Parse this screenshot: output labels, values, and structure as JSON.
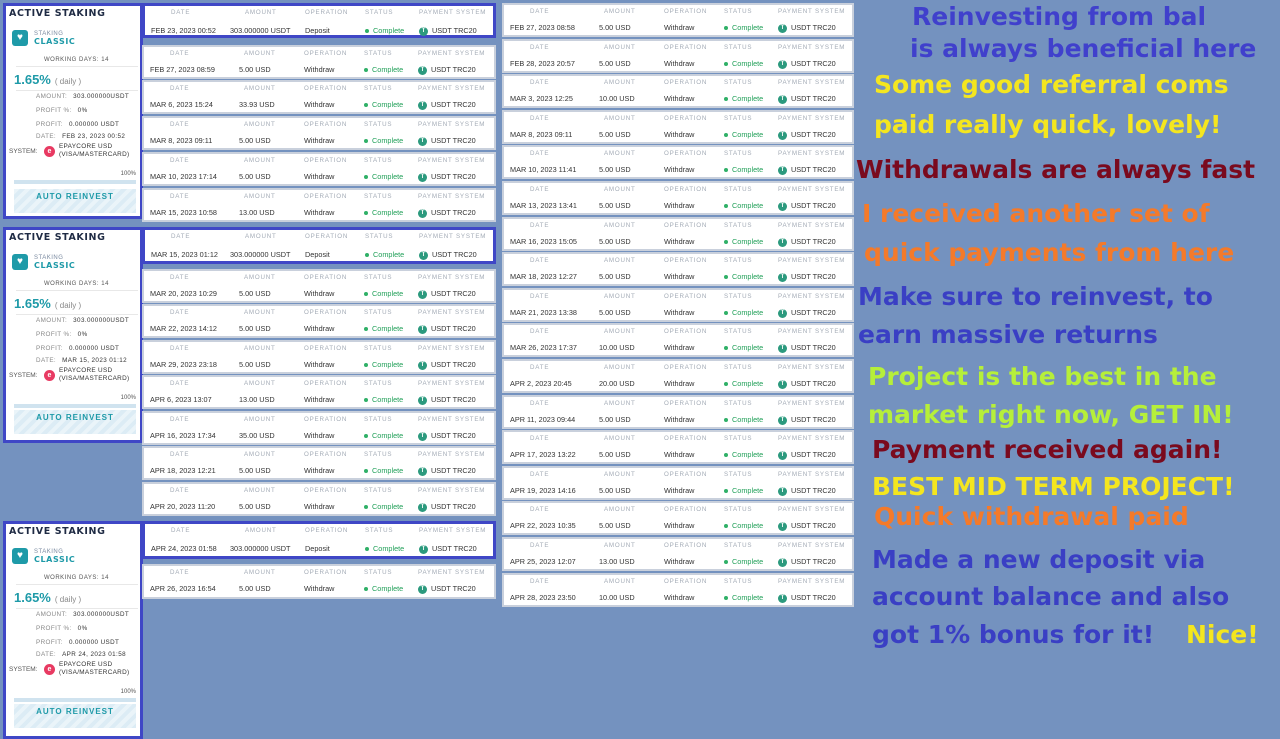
{
  "staking_cards": [
    {
      "title": "ACTIVE STAKING",
      "label": "STAKING",
      "plan": "CLASSIC",
      "working_days": "WORKING DAYS: 14",
      "rate": "1.65%",
      "period": "( daily )",
      "amount_label": "AMOUNT:",
      "amount": "303.000000USDT",
      "profit_label": "PROFIT %:",
      "profit_pct": "0%",
      "profit2_label": "PROFIT:",
      "profit": "0.000000 USDT",
      "date_label": "DATE:",
      "date": "FEB 23, 2023 00:52",
      "system_label": "SYSTEM:",
      "system_line1": "EPAYCORE USD",
      "system_line2": "(VISA/MASTERCARD)",
      "progress_label": "100%",
      "progress": 1.0,
      "button": "AUTO REINVEST"
    },
    {
      "title": "ACTIVE STAKING",
      "label": "STAKING",
      "plan": "CLASSIC",
      "working_days": "WORKING DAYS: 14",
      "rate": "1.65%",
      "period": "( daily )",
      "amount_label": "AMOUNT:",
      "amount": "303.000000USDT",
      "profit_label": "PROFIT %:",
      "profit_pct": "0%",
      "profit2_label": "PROFIT:",
      "profit": "0.000000 USDT",
      "date_label": "DATE:",
      "date": "MAR 15, 2023 01:12",
      "system_label": "SYSTEM:",
      "system_line1": "EPAYCORE USD",
      "system_line2": "(VISA/MASTERCARD)",
      "progress_label": "100%",
      "progress": 1.0,
      "button": "AUTO REINVEST"
    },
    {
      "title": "ACTIVE STAKING",
      "label": "STAKING",
      "plan": "CLASSIC",
      "working_days": "WORKING DAYS: 14",
      "rate": "1.65%",
      "period": "( daily )",
      "amount_label": "AMOUNT:",
      "amount": "303.000000USDT",
      "profit_label": "PROFIT %:",
      "profit_pct": "0%",
      "profit2_label": "PROFIT:",
      "profit": "0.000000 USDT",
      "date_label": "DATE:",
      "date": "APR 24, 2023 01:58",
      "system_label": "SYSTEM:",
      "system_line1": "EPAYCORE USD",
      "system_line2": "(VISA/MASTERCARD)",
      "progress_label": "100%",
      "progress": 1.0,
      "button": "AUTO REINVEST"
    }
  ],
  "headers": {
    "date": "DATE",
    "amount": "AMOUNT",
    "operation": "OPERATION",
    "status": "STATUS",
    "payment_system": "PAYMENT SYSTEM"
  },
  "status_text": "Complete",
  "payment_system": "USDT TRC20",
  "column1": [
    {
      "date": "FEB 23, 2023 00:52",
      "amount": "303.000000 USDT",
      "operation": "Deposit"
    },
    {
      "date": "FEB 27, 2023 08:59",
      "amount": "5.00 USD",
      "operation": "Withdraw"
    },
    {
      "date": "MAR 6, 2023 15:24",
      "amount": "33.93 USD",
      "operation": "Withdraw"
    },
    {
      "date": "MAR 8, 2023 09:11",
      "amount": "5.00 USD",
      "operation": "Withdraw"
    },
    {
      "date": "MAR 10, 2023 17:14",
      "amount": "5.00 USD",
      "operation": "Withdraw"
    },
    {
      "date": "MAR 15, 2023 10:58",
      "amount": "13.00 USD",
      "operation": "Withdraw"
    },
    {
      "date": "MAR 15, 2023 01:12",
      "amount": "303.000000 USDT",
      "operation": "Deposit"
    },
    {
      "date": "MAR 20, 2023 10:29",
      "amount": "5.00 USD",
      "operation": "Withdraw"
    },
    {
      "date": "MAR 22, 2023 14:12",
      "amount": "5.00 USD",
      "operation": "Withdraw"
    },
    {
      "date": "MAR 29, 2023 23:18",
      "amount": "5.00 USD",
      "operation": "Withdraw"
    },
    {
      "date": "APR 6, 2023 13:07",
      "amount": "13.00 USD",
      "operation": "Withdraw"
    },
    {
      "date": "APR 16, 2023 17:34",
      "amount": "35.00 USD",
      "operation": "Withdraw"
    },
    {
      "date": "APR 18, 2023 12:21",
      "amount": "5.00 USD",
      "operation": "Withdraw"
    },
    {
      "date": "APR 20, 2023 11:20",
      "amount": "5.00 USD",
      "operation": "Withdraw"
    },
    {
      "date": "APR 24, 2023 01:58",
      "amount": "303.000000 USDT",
      "operation": "Deposit"
    },
    {
      "date": "APR 26, 2023 16:54",
      "amount": "5.00 USD",
      "operation": "Withdraw"
    }
  ],
  "column2": [
    {
      "date": "FEB 27, 2023 08:58",
      "amount": "5.00 USD",
      "operation": "Withdraw"
    },
    {
      "date": "FEB 28, 2023 20:57",
      "amount": "5.00 USD",
      "operation": "Withdraw"
    },
    {
      "date": "MAR 3, 2023 12:25",
      "amount": "10.00 USD",
      "operation": "Withdraw"
    },
    {
      "date": "MAR 8, 2023 09:11",
      "amount": "5.00 USD",
      "operation": "Withdraw"
    },
    {
      "date": "MAR 10, 2023 11:41",
      "amount": "5.00 USD",
      "operation": "Withdraw"
    },
    {
      "date": "MAR 13, 2023 13:41",
      "amount": "5.00 USD",
      "operation": "Withdraw"
    },
    {
      "date": "MAR 16, 2023 15:05",
      "amount": "5.00 USD",
      "operation": "Withdraw"
    },
    {
      "date": "MAR 18, 2023 12:27",
      "amount": "5.00 USD",
      "operation": "Withdraw"
    },
    {
      "date": "MAR 21, 2023 13:38",
      "amount": "5.00 USD",
      "operation": "Withdraw"
    },
    {
      "date": "MAR 26, 2023 17:37",
      "amount": "10.00 USD",
      "operation": "Withdraw"
    },
    {
      "date": "APR 2, 2023 20:45",
      "amount": "20.00 USD",
      "operation": "Withdraw"
    },
    {
      "date": "APR 11, 2023 09:44",
      "amount": "5.00 USD",
      "operation": "Withdraw"
    },
    {
      "date": "APR 17, 2023 13:22",
      "amount": "5.00 USD",
      "operation": "Withdraw"
    },
    {
      "date": "APR 19, 2023 14:16",
      "amount": "5.00 USD",
      "operation": "Withdraw"
    },
    {
      "date": "APR 22, 2023 10:35",
      "amount": "5.00 USD",
      "operation": "Withdraw"
    },
    {
      "date": "APR 25, 2023 12:07",
      "amount": "13.00 USD",
      "operation": "Withdraw"
    },
    {
      "date": "APR 28, 2023 23:50",
      "amount": "10.00 USD",
      "operation": "Withdraw"
    }
  ],
  "messages": [
    {
      "text": "Reinvesting from bal",
      "color": "#4040cc"
    },
    {
      "text": "is always beneficial here",
      "color": "#4040cc"
    },
    {
      "text": "Some good referral coms",
      "color": "#f4e61f"
    },
    {
      "text": "paid really quick, lovely!",
      "color": "#f4e61f"
    },
    {
      "text": "Withdrawals are always fast",
      "color": "#7a0a1e"
    },
    {
      "text": "I received another set of",
      "color": "#f47a2a"
    },
    {
      "text": "quick payments from here",
      "color": "#f47a2a"
    },
    {
      "text": "Make sure to reinvest, to",
      "color": "#3a3fc4"
    },
    {
      "text": "earn massive returns",
      "color": "#3a3fc4"
    },
    {
      "text": "Project is the best in the",
      "color": "#b6ef3a"
    },
    {
      "text": "market right now, GET IN!",
      "color": "#b6ef3a"
    },
    {
      "text": "Payment received again!",
      "color": "#7a0a1e"
    },
    {
      "text": "BEST MID TERM PROJECT!",
      "color": "#f4e61f"
    },
    {
      "text": "Quick withdrawal paid",
      "color": "#f47a2a"
    },
    {
      "text": "Made a new deposit via",
      "color": "#3a3fc4"
    },
    {
      "text": "account balance and also",
      "color": "#3a3fc4"
    },
    {
      "text": "got 1% bonus for it!",
      "color": "#3a3fc4"
    },
    {
      "text": "Nice!",
      "color": "#f4e61f"
    }
  ]
}
